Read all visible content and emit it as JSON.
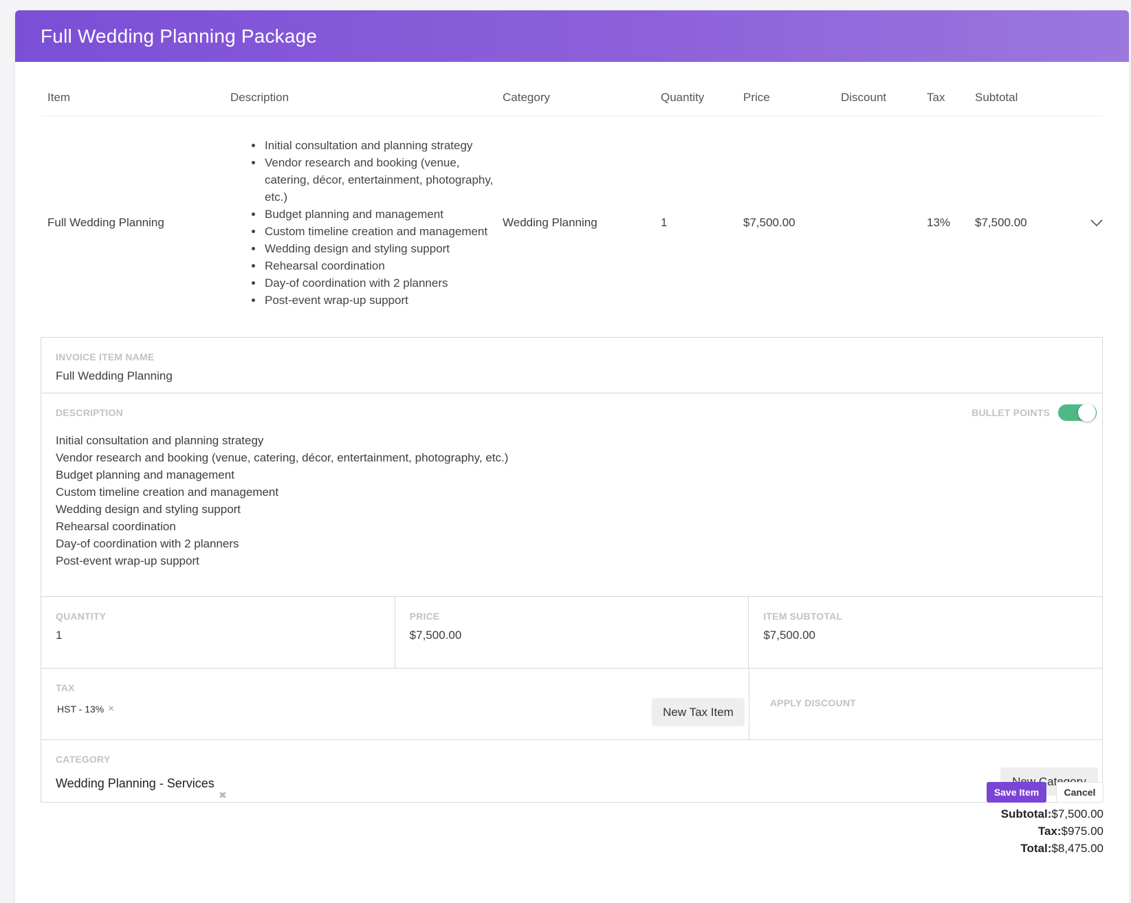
{
  "header": {
    "title": "Full Wedding Planning Package"
  },
  "table": {
    "columns": [
      "Item",
      "Description",
      "Category",
      "Quantity",
      "Price",
      "Discount",
      "Tax",
      "Subtotal"
    ],
    "row": {
      "item": "Full Wedding Planning",
      "description": [
        "Initial consultation and planning strategy",
        "Vendor research and booking (venue, catering, décor, entertainment, photography, etc.)",
        "Budget planning and management",
        "Custom timeline creation and management",
        "Wedding design and styling support",
        "Rehearsal coordination",
        "Day-of coordination with 2 planners",
        "Post-event wrap-up support"
      ],
      "category": "Wedding Planning",
      "quantity": "1",
      "price": "$7,500.00",
      "discount": "",
      "tax": "13%",
      "subtotal": "$7,500.00"
    }
  },
  "editor": {
    "name_label": "INVOICE ITEM NAME",
    "name_value": "Full Wedding Planning",
    "desc_label": "DESCRIPTION",
    "bullet_label": "BULLET POINTS",
    "bullet_enabled": true,
    "desc_lines": [
      "Initial consultation and planning strategy",
      "Vendor research and booking (venue, catering, décor, entertainment, photography, etc.)",
      "Budget planning and management",
      "Custom timeline creation and management",
      "Wedding design and styling support",
      "Rehearsal coordination",
      "Day-of coordination with 2 planners",
      "Post-event wrap-up support"
    ],
    "quantity_label": "QUANTITY",
    "quantity_value": "1",
    "price_label": "PRICE",
    "price_value": "$7,500.00",
    "item_subtotal_label": "ITEM SUBTOTAL",
    "item_subtotal_value": "$7,500.00",
    "tax_label": "TAX",
    "tax_chip": "HST - 13%",
    "new_tax_button": "New Tax Item",
    "discount_label": "APPLY DISCOUNT",
    "category_label": "CATEGORY",
    "category_value": "Wedding Planning - Services",
    "new_category_button": "New Category"
  },
  "actions": {
    "save": "Save Item",
    "cancel": "Cancel"
  },
  "totals": {
    "subtotal_label": "Subtotal:",
    "subtotal_value": "$7,500.00",
    "tax_label": "Tax:",
    "tax_value": "$975.00",
    "total_label": "Total:",
    "total_value": "$8,475.00"
  },
  "colors": {
    "accent": "#7a45d4",
    "toggle_on": "#4fb985"
  },
  "icons": {
    "expand": "chevron-down-icon",
    "remove": "close-icon"
  }
}
